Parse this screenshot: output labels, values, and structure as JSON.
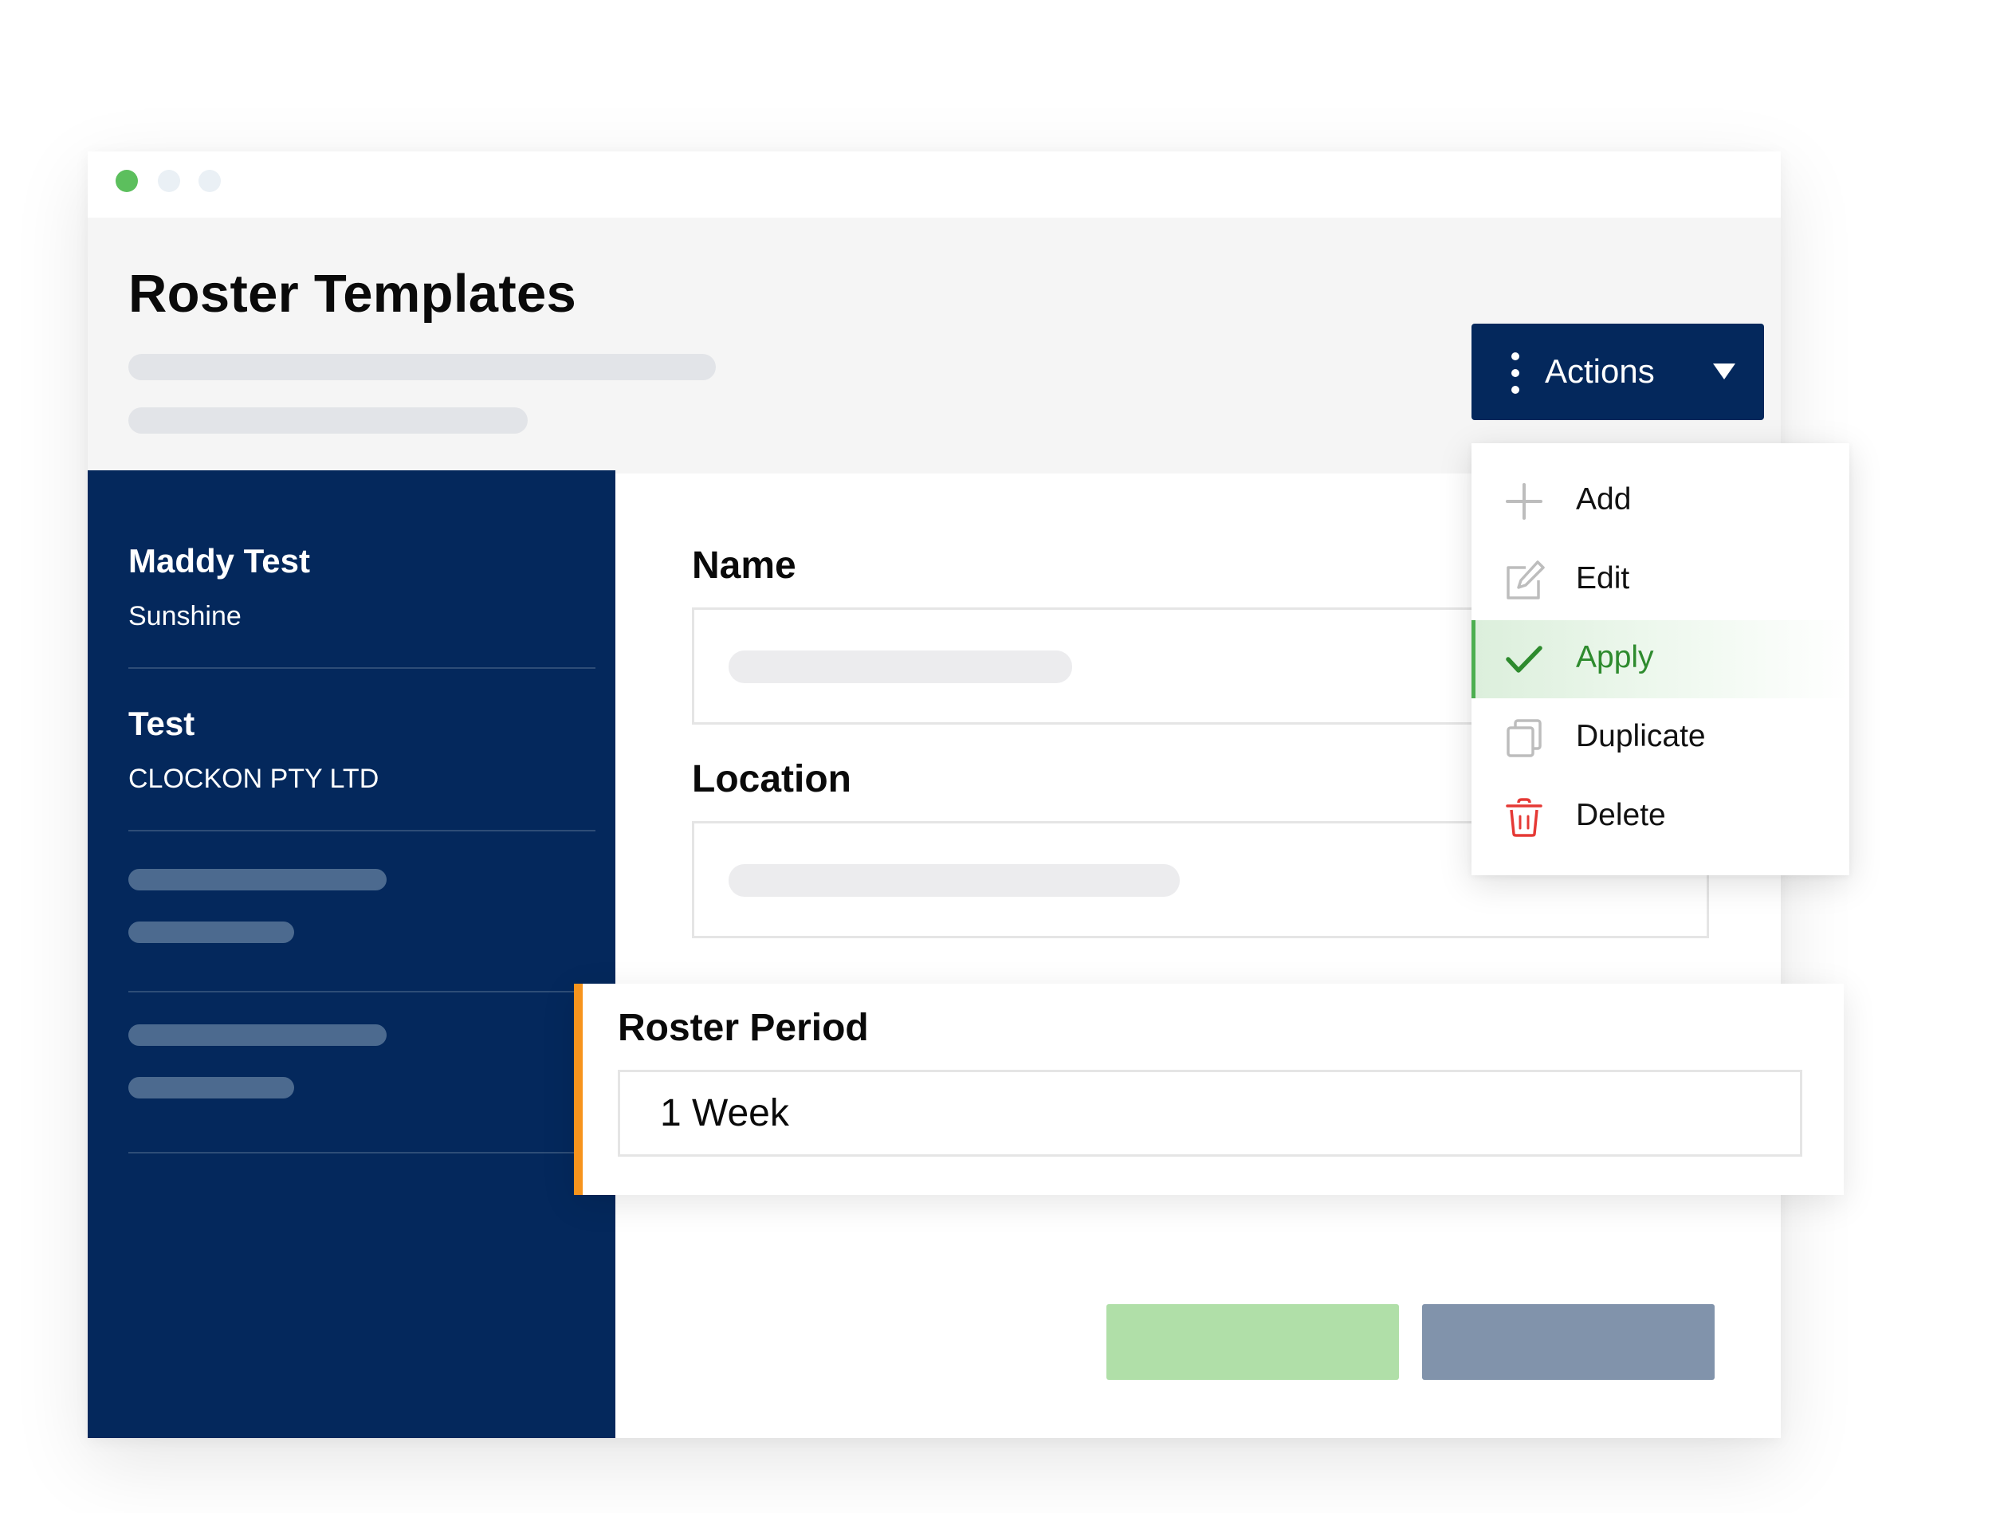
{
  "window": {
    "controls": [
      "close",
      "minimize",
      "maximize"
    ]
  },
  "header": {
    "title": "Roster Templates"
  },
  "actions": {
    "label": "Actions"
  },
  "menu": {
    "items": [
      {
        "label": "Add",
        "icon": "plus-icon"
      },
      {
        "label": "Edit",
        "icon": "edit-icon"
      },
      {
        "label": "Apply",
        "icon": "check-icon",
        "active": true
      },
      {
        "label": "Duplicate",
        "icon": "duplicate-icon"
      },
      {
        "label": "Delete",
        "icon": "trash-icon"
      }
    ]
  },
  "sidebar": {
    "items": [
      {
        "title": "Maddy Test",
        "subtitle": "Sunshine"
      },
      {
        "title": "Test",
        "subtitle": "CLOCKON PTY LTD"
      }
    ]
  },
  "form": {
    "name_label": "Name",
    "location_label": "Location",
    "roster_period_label": "Roster Period",
    "roster_period_value": "1 Week"
  },
  "colors": {
    "navy": "#04285c",
    "accent_orange": "#f7941d",
    "success_green": "#2e8b2e",
    "window_dot_green": "#5cbf5d",
    "delete_red": "#e53935",
    "save_button": "#b0dfa8",
    "cancel_button": "#8193ab"
  }
}
